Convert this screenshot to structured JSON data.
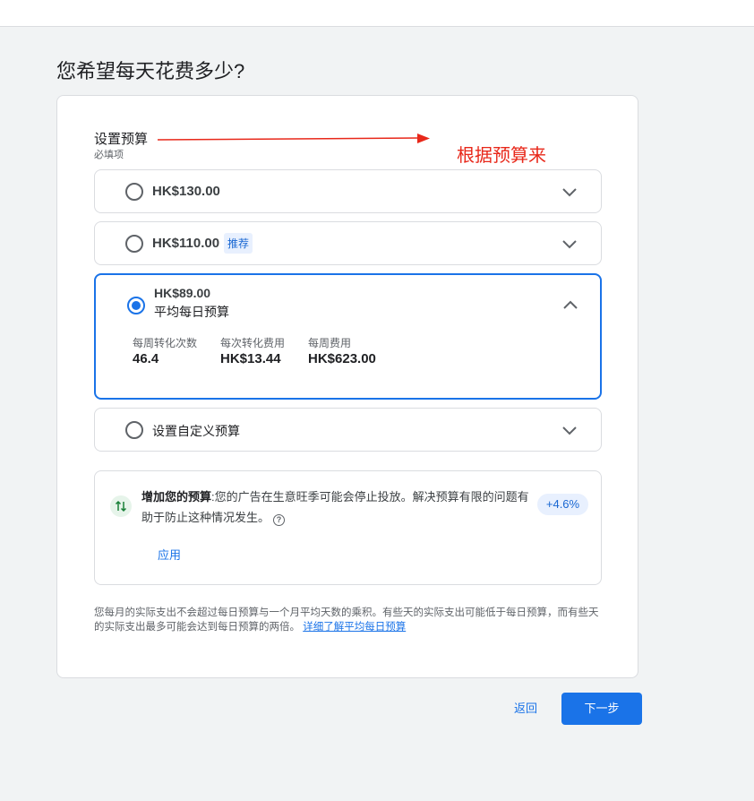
{
  "page": {
    "title": "您希望每天花费多少?"
  },
  "budget_section": {
    "title": "设置预算",
    "required": "必填项"
  },
  "annotation": {
    "text": "根据预算来",
    "color": "#e8281a"
  },
  "options": [
    {
      "label": "HK$130.00",
      "selected": false
    },
    {
      "label": "HK$110.00",
      "badge": "推荐",
      "selected": false
    },
    {
      "label": "HK$89.00",
      "sublabel": "平均每日预算",
      "selected": true,
      "stats": [
        {
          "label": "每周转化次数",
          "value": "46.4"
        },
        {
          "label": "每次转化费用",
          "value": "HK$13.44"
        },
        {
          "label": "每周费用",
          "value": "HK$623.00"
        }
      ]
    },
    {
      "label": "设置自定义预算",
      "selected": false
    }
  ],
  "tip": {
    "title": "增加您的预算",
    "body": ":您的广告在生意旺季可能会停止投放。解决预算有限的问题有助于防止这种情况发生。",
    "percent": "+4.6%",
    "apply_label": "应用"
  },
  "note": {
    "text": "您每月的实际支出不会超过每日预算与一个月平均天数的乘积。有些天的实际支出可能低于每日预算，而有些天的实际支出最多可能会达到每日预算的两倍。",
    "link": "详细了解平均每日预算"
  },
  "buttons": {
    "back": "返回",
    "next": "下一步"
  },
  "colors": {
    "accent": "#1a73e8",
    "background": "#f1f3f4"
  }
}
